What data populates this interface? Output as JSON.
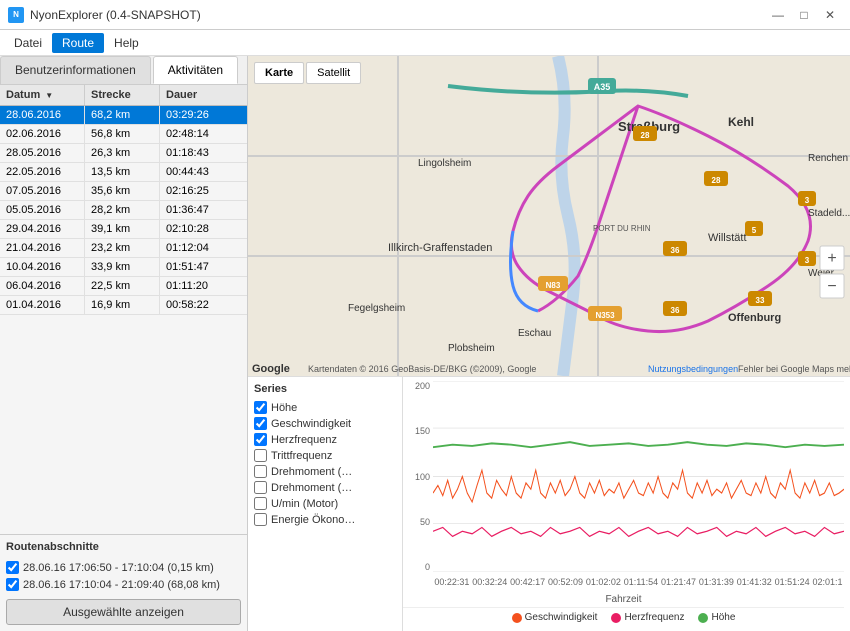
{
  "titleBar": {
    "icon": "N",
    "title": "NyonExplorer (0.4-SNAPSHOT)",
    "controls": {
      "minimize": "—",
      "maximize": "□",
      "close": "✕"
    }
  },
  "menuBar": {
    "items": [
      "Datei",
      "Route",
      "Help"
    ]
  },
  "leftPanel": {
    "tabs": [
      "Benutzerinformationen",
      "Aktivitäten"
    ],
    "activeTab": 1,
    "tableHeaders": [
      "Datum",
      "Strecke",
      "Dauer"
    ],
    "tableRows": [
      {
        "date": "28.06.2016",
        "distance": "68,2 km",
        "duration": "03:29:26",
        "selected": true
      },
      {
        "date": "02.06.2016",
        "distance": "56,8 km",
        "duration": "02:48:14"
      },
      {
        "date": "28.05.2016",
        "distance": "26,3 km",
        "duration": "01:18:43"
      },
      {
        "date": "22.05.2016",
        "distance": "13,5 km",
        "duration": "00:44:43"
      },
      {
        "date": "07.05.2016",
        "distance": "35,6 km",
        "duration": "02:16:25"
      },
      {
        "date": "05.05.2016",
        "distance": "28,2 km",
        "duration": "01:36:47"
      },
      {
        "date": "29.04.2016",
        "distance": "39,1 km",
        "duration": "02:10:28"
      },
      {
        "date": "21.04.2016",
        "distance": "23,2 km",
        "duration": "01:12:04"
      },
      {
        "date": "10.04.2016",
        "distance": "33,9 km",
        "duration": "01:51:47"
      },
      {
        "date": "06.04.2016",
        "distance": "22,5 km",
        "duration": "01:11:20"
      },
      {
        "date": "01.04.2016",
        "distance": "16,9 km",
        "duration": "00:58:22"
      }
    ],
    "routeSectionsTitle": "Routenabschnitte",
    "routeSections": [
      {
        "label": "28.06.16 17:06:50 - 17:10:04 (0,15 km)",
        "checked": true
      },
      {
        "label": "28.06.16 17:10:04 - 21:09:40 (68,08 km)",
        "checked": true
      }
    ],
    "showButton": "Ausgewählte anzeigen"
  },
  "mapPanel": {
    "buttons": [
      "Karte",
      "Satellit"
    ],
    "activeButton": 0,
    "zoomIn": "+",
    "zoomOut": "−",
    "attribution": "Kartendaten © 2016 GeoBasis-DE/BKG (©2009), Google",
    "terms": "Nutzungsbedingungen",
    "error": "Fehler bei Google Maps melden"
  },
  "chartPanel": {
    "seriesTitle": "Series",
    "seriesItems": [
      {
        "label": "Höhe",
        "checked": true
      },
      {
        "label": "Geschwindigkeit",
        "checked": true
      },
      {
        "label": "Herzfrequenz",
        "checked": true
      },
      {
        "label": "Trittfrequenz",
        "checked": false
      },
      {
        "label": "Drehmoment (…",
        "checked": false
      },
      {
        "label": "Drehmoment (…",
        "checked": false
      },
      {
        "label": "U/min (Motor)",
        "checked": false
      },
      {
        "label": "Energie Ökono…",
        "checked": false
      }
    ],
    "yAxisLabels": [
      "200",
      "150",
      "100",
      "50",
      "0"
    ],
    "xAxisLabels": [
      "00:22:31",
      "00:32:24",
      "00:42:17",
      "00:52:09",
      "01:02:02",
      "01:11:54",
      "01:21:47",
      "01:31:39",
      "01:41:32",
      "01:51:24",
      "02:01:1"
    ],
    "xAxisTitle": "Fahrzeit",
    "legend": [
      {
        "label": "Geschwindigkeit",
        "color": "#f4511e"
      },
      {
        "label": "Herzfrequenz",
        "color": "#e91e63"
      },
      {
        "label": "Höhe",
        "color": "#4caf50"
      }
    ]
  }
}
